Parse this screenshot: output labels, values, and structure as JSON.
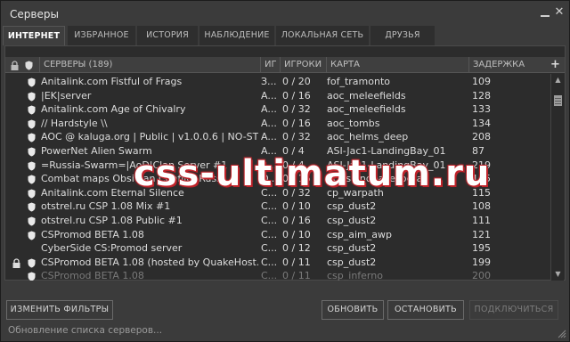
{
  "window": {
    "title": "Серверы"
  },
  "tabs": [
    {
      "label": "ИНТЕРНЕТ",
      "active": true
    },
    {
      "label": "ИЗБРАННОЕ"
    },
    {
      "label": "ИСТОРИЯ"
    },
    {
      "label": "НАБЛЮДЕНИЕ"
    },
    {
      "label": "ЛОКАЛЬНАЯ СЕТЬ"
    },
    {
      "label": "ДРУЗЬЯ"
    }
  ],
  "columns": {
    "servers": "СЕРВЕРЫ (189)",
    "game": "ИГ",
    "players": "ИГРОКИ",
    "map": "КАРТА",
    "latency": "ЗАДЕРЖКА",
    "add": "+"
  },
  "servers": [
    {
      "name": "Anitalink.com Fistful of Frags",
      "game": "З...",
      "players": "0 / 20",
      "map": "fof_tramonto",
      "latency": "109",
      "locked": false
    },
    {
      "name": "|EK|server",
      "game": "A...",
      "players": "0 / 16",
      "map": "aoc_meleefields",
      "latency": "128",
      "locked": false
    },
    {
      "name": "Anitalink.com Age of Chivalry",
      "game": "A...",
      "players": "0 / 32",
      "map": "aoc_meleefields",
      "latency": "133",
      "locked": false
    },
    {
      "name": "// Hardstyle \\\\",
      "game": "A...",
      "players": "0 / 16",
      "map": "aoc_tombs",
      "latency": "134",
      "locked": false
    },
    {
      "name": "AOC @ kaluga.org | Public | v1.0.0.6 | NO-STE...",
      "game": "A...",
      "players": "0 / 32",
      "map": "aoc_helms_deep",
      "latency": "208",
      "locked": false
    },
    {
      "name": "PowerNet Alien Swarm",
      "game": "A...",
      "players": "0 / 4",
      "map": "ASI-Jac1-LandingBay_01",
      "latency": "87",
      "locked": false
    },
    {
      "name": "=Russia-Swarm=|AoD|Clan Server #1",
      "game": "A...",
      "players": "0 / 4",
      "map": "ASI-Jac1-LandingBay_01",
      "latency": "219",
      "locked": false
    },
    {
      "name": "Combat maps Obsidian Conflict Russ",
      "game": "O...",
      "players": "0 / 16",
      "map": "oc_islandbase_beta",
      "latency": "155",
      "locked": false
    },
    {
      "name": "Anitalink.com Eternal Silence",
      "game": "C...",
      "players": "0 / 32",
      "map": "cp_warpath",
      "latency": "115",
      "locked": false
    },
    {
      "name": "otstrel.ru CSP 1.08 Mix #1",
      "game": "C...",
      "players": "0 / 10",
      "map": "csp_dust2",
      "latency": "108",
      "locked": false
    },
    {
      "name": "otstrel.ru CSP 1.08 Public #1",
      "game": "C...",
      "players": "0 / 16",
      "map": "csp_dust2",
      "latency": "111",
      "locked": false
    },
    {
      "name": "CSPromod BETA 1.08",
      "game": "C...",
      "players": "0 / 10",
      "map": "csp_aim_awp",
      "latency": "121",
      "locked": false
    },
    {
      "name": "CyberSide CS:Promod server",
      "game": "C...",
      "players": "0 / 12",
      "map": "csp_dust2",
      "latency": "195",
      "locked": false,
      "noshield": true
    },
    {
      "name": "CSPromod BETA 1.08 (hosted by QuakeHost.ru)",
      "game": "C...",
      "players": "0 / 11",
      "map": "csp_dust2",
      "latency": "199",
      "locked": true
    },
    {
      "name": "CSPromod BETA 1.08",
      "game": "C...",
      "players": "0 / 11",
      "map": "csp_inferno",
      "latency": "200",
      "locked": false,
      "dim": true
    }
  ],
  "buttons": {
    "filters": "ИЗМЕНИТЬ ФИЛЬТРЫ",
    "refresh": "ОБНОВИТЬ",
    "stop": "ОСТАНОВИТЬ",
    "connect": "ПОДКЛЮЧИТЬСЯ"
  },
  "status": "Обновление списка серверов...",
  "watermark": "css-ultimatum.ru",
  "colors": {
    "background": "#3b3b3b",
    "list": "#2c2c2c",
    "watermark_stroke": "#c0242b"
  }
}
